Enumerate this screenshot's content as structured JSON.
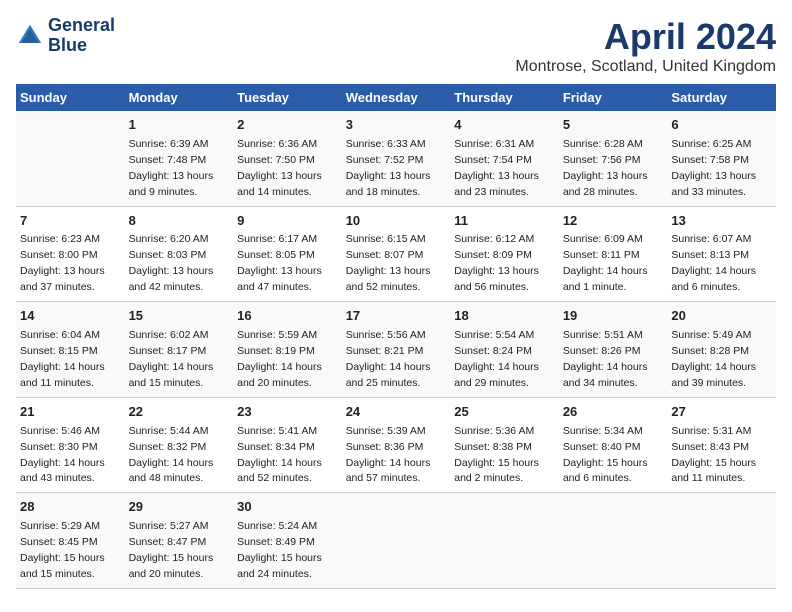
{
  "header": {
    "logo_line1": "General",
    "logo_line2": "Blue",
    "title": "April 2024",
    "location": "Montrose, Scotland, United Kingdom"
  },
  "weekdays": [
    "Sunday",
    "Monday",
    "Tuesday",
    "Wednesday",
    "Thursday",
    "Friday",
    "Saturday"
  ],
  "weeks": [
    [
      {
        "day": "",
        "info": ""
      },
      {
        "day": "1",
        "info": "Sunrise: 6:39 AM\nSunset: 7:48 PM\nDaylight: 13 hours\nand 9 minutes."
      },
      {
        "day": "2",
        "info": "Sunrise: 6:36 AM\nSunset: 7:50 PM\nDaylight: 13 hours\nand 14 minutes."
      },
      {
        "day": "3",
        "info": "Sunrise: 6:33 AM\nSunset: 7:52 PM\nDaylight: 13 hours\nand 18 minutes."
      },
      {
        "day": "4",
        "info": "Sunrise: 6:31 AM\nSunset: 7:54 PM\nDaylight: 13 hours\nand 23 minutes."
      },
      {
        "day": "5",
        "info": "Sunrise: 6:28 AM\nSunset: 7:56 PM\nDaylight: 13 hours\nand 28 minutes."
      },
      {
        "day": "6",
        "info": "Sunrise: 6:25 AM\nSunset: 7:58 PM\nDaylight: 13 hours\nand 33 minutes."
      }
    ],
    [
      {
        "day": "7",
        "info": "Sunrise: 6:23 AM\nSunset: 8:00 PM\nDaylight: 13 hours\nand 37 minutes."
      },
      {
        "day": "8",
        "info": "Sunrise: 6:20 AM\nSunset: 8:03 PM\nDaylight: 13 hours\nand 42 minutes."
      },
      {
        "day": "9",
        "info": "Sunrise: 6:17 AM\nSunset: 8:05 PM\nDaylight: 13 hours\nand 47 minutes."
      },
      {
        "day": "10",
        "info": "Sunrise: 6:15 AM\nSunset: 8:07 PM\nDaylight: 13 hours\nand 52 minutes."
      },
      {
        "day": "11",
        "info": "Sunrise: 6:12 AM\nSunset: 8:09 PM\nDaylight: 13 hours\nand 56 minutes."
      },
      {
        "day": "12",
        "info": "Sunrise: 6:09 AM\nSunset: 8:11 PM\nDaylight: 14 hours\nand 1 minute."
      },
      {
        "day": "13",
        "info": "Sunrise: 6:07 AM\nSunset: 8:13 PM\nDaylight: 14 hours\nand 6 minutes."
      }
    ],
    [
      {
        "day": "14",
        "info": "Sunrise: 6:04 AM\nSunset: 8:15 PM\nDaylight: 14 hours\nand 11 minutes."
      },
      {
        "day": "15",
        "info": "Sunrise: 6:02 AM\nSunset: 8:17 PM\nDaylight: 14 hours\nand 15 minutes."
      },
      {
        "day": "16",
        "info": "Sunrise: 5:59 AM\nSunset: 8:19 PM\nDaylight: 14 hours\nand 20 minutes."
      },
      {
        "day": "17",
        "info": "Sunrise: 5:56 AM\nSunset: 8:21 PM\nDaylight: 14 hours\nand 25 minutes."
      },
      {
        "day": "18",
        "info": "Sunrise: 5:54 AM\nSunset: 8:24 PM\nDaylight: 14 hours\nand 29 minutes."
      },
      {
        "day": "19",
        "info": "Sunrise: 5:51 AM\nSunset: 8:26 PM\nDaylight: 14 hours\nand 34 minutes."
      },
      {
        "day": "20",
        "info": "Sunrise: 5:49 AM\nSunset: 8:28 PM\nDaylight: 14 hours\nand 39 minutes."
      }
    ],
    [
      {
        "day": "21",
        "info": "Sunrise: 5:46 AM\nSunset: 8:30 PM\nDaylight: 14 hours\nand 43 minutes."
      },
      {
        "day": "22",
        "info": "Sunrise: 5:44 AM\nSunset: 8:32 PM\nDaylight: 14 hours\nand 48 minutes."
      },
      {
        "day": "23",
        "info": "Sunrise: 5:41 AM\nSunset: 8:34 PM\nDaylight: 14 hours\nand 52 minutes."
      },
      {
        "day": "24",
        "info": "Sunrise: 5:39 AM\nSunset: 8:36 PM\nDaylight: 14 hours\nand 57 minutes."
      },
      {
        "day": "25",
        "info": "Sunrise: 5:36 AM\nSunset: 8:38 PM\nDaylight: 15 hours\nand 2 minutes."
      },
      {
        "day": "26",
        "info": "Sunrise: 5:34 AM\nSunset: 8:40 PM\nDaylight: 15 hours\nand 6 minutes."
      },
      {
        "day": "27",
        "info": "Sunrise: 5:31 AM\nSunset: 8:43 PM\nDaylight: 15 hours\nand 11 minutes."
      }
    ],
    [
      {
        "day": "28",
        "info": "Sunrise: 5:29 AM\nSunset: 8:45 PM\nDaylight: 15 hours\nand 15 minutes."
      },
      {
        "day": "29",
        "info": "Sunrise: 5:27 AM\nSunset: 8:47 PM\nDaylight: 15 hours\nand 20 minutes."
      },
      {
        "day": "30",
        "info": "Sunrise: 5:24 AM\nSunset: 8:49 PM\nDaylight: 15 hours\nand 24 minutes."
      },
      {
        "day": "",
        "info": ""
      },
      {
        "day": "",
        "info": ""
      },
      {
        "day": "",
        "info": ""
      },
      {
        "day": "",
        "info": ""
      }
    ]
  ]
}
